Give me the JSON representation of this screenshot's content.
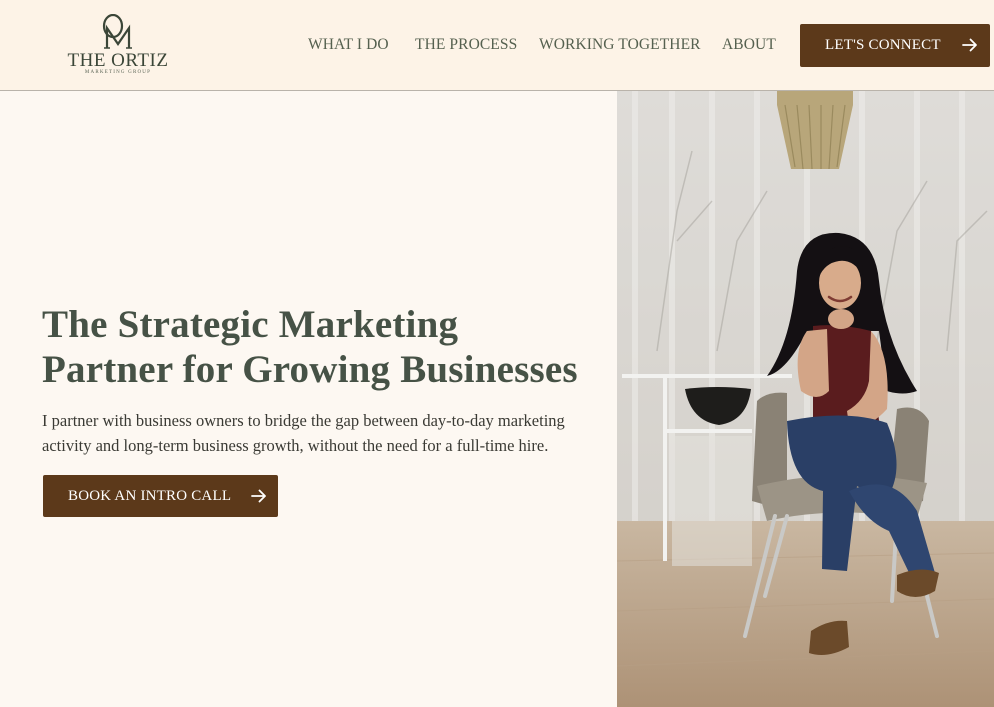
{
  "brand": {
    "monogram": "OM",
    "name": "THE ORTIZ",
    "tagline": "MARKETING GROUP"
  },
  "nav": {
    "items": [
      "WHAT I DO",
      "THE PROCESS",
      "WORKING TOGETHER",
      "ABOUT"
    ],
    "cta_label": "LET'S CONNECT"
  },
  "hero": {
    "title_line1": "The Strategic Marketing",
    "title_line2": "Partner for Growing Businesses",
    "text_line1": "I partner with business owners to bridge the gap between day-to-day marketing",
    "text_line2": "activity and long-term business growth, without the need for a full-time hire.",
    "cta_label": "BOOK AN INTRO CALL"
  },
  "icons": {
    "arrow": "arrow-right-icon"
  },
  "colors": {
    "header_bg": "#fdf3e7",
    "page_bg": "#fdf8f2",
    "button_bg": "#5c391a",
    "heading": "#465246"
  }
}
